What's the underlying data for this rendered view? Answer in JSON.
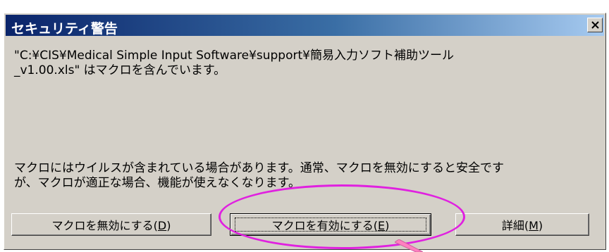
{
  "window": {
    "title": "セキュリティ警告",
    "close_glyph": "×"
  },
  "message": {
    "file_line1": "\"C:¥CIS¥Medical Simple Input Software¥support¥簡易入力ソフト補助ツール",
    "file_line2": "_v1.00.xls\" はマクロを含んでいます。",
    "warning_line1": "マクロにはウイルスが含まれている場合があります。通常、マクロを無効にすると安全です",
    "warning_line2": "が、マクロが適正な場合、機能が使えなくなります。"
  },
  "buttons": {
    "disable": {
      "label": "マクロを無効にする(",
      "mnemonic": "D",
      "suffix": ")"
    },
    "enable": {
      "label": "マクロを有効にする(",
      "mnemonic": "E",
      "suffix": ")"
    },
    "details": {
      "label": "詳細(",
      "mnemonic": "M",
      "suffix": ")"
    }
  },
  "annotation": {
    "highlight_color": "#e020e0",
    "arrow_color": "#ff80c0"
  }
}
